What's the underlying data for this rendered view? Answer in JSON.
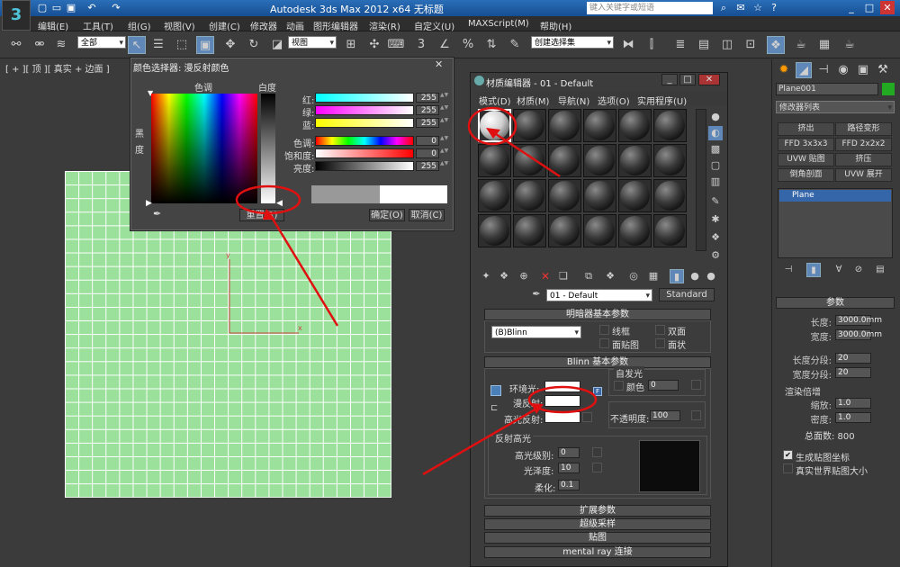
{
  "titlebar": {
    "app_title": "Autodesk 3ds Max  2012 x64     无标题",
    "search_placeholder": "键入关键字或短语",
    "logo": "3ds-max-logo"
  },
  "menus": [
    "编辑(E)",
    "工具(T)",
    "组(G)",
    "视图(V)",
    "创建(C)",
    "修改器",
    "动画",
    "图形编辑器",
    "渲染(R)",
    "自定义(U)",
    "MAXScript(M)",
    "帮助(H)"
  ],
  "toolbar": {
    "filter": "全部",
    "ref_coord": "视图",
    "named_sel": "创建选择集"
  },
  "viewport": {
    "label": "[ + ][ 顶 ][ 真实 + 边面 ]",
    "axis_x": "x",
    "axis_y": "y"
  },
  "color_picker": {
    "title": "颜色选择器: 漫反射颜色",
    "hue_label": "色调",
    "whiteness_label": "白度",
    "black_label": "黑",
    "degree_label": "度",
    "rows": [
      {
        "label": "红:",
        "value": "255"
      },
      {
        "label": "绿:",
        "value": "255"
      },
      {
        "label": "蓝:",
        "value": "255"
      },
      {
        "label": "色调:",
        "value": "0"
      },
      {
        "label": "饱和度:",
        "value": "0"
      },
      {
        "label": "亮度:",
        "value": "255"
      }
    ],
    "reset": "重置(R)",
    "ok": "确定(O)",
    "cancel": "取消(C)"
  },
  "material_editor": {
    "title": "材质编辑器 - 01 - Default",
    "menu": [
      "模式(D)",
      "材质(M)",
      "导航(N)",
      "选项(O)",
      "实用程序(U)"
    ],
    "material_name": "01 - Default",
    "material_type": "Standard",
    "shader_rollout": "明暗器基本参数",
    "shader": "(B)Blinn",
    "opts": [
      "线框",
      "双面",
      "面贴图",
      "面状"
    ],
    "blinn_rollout": "Blinn 基本参数",
    "self_illum": "自发光",
    "self_color": "颜色",
    "self_value": "0",
    "ambient": "环境光:",
    "diffuse": "漫反射:",
    "specular": "高光反射:",
    "opacity_label": "不透明度:",
    "opacity": "100",
    "spec_group": "反射高光",
    "spec_level_lbl": "高光级别:",
    "spec_level": "0",
    "gloss_lbl": "光泽度:",
    "gloss": "10",
    "soften_lbl": "柔化:",
    "soften": "0.1",
    "rollouts": [
      "扩展参数",
      "超级采样",
      "贴图",
      "mental ray 连接"
    ]
  },
  "command_panel": {
    "object_name": "Plane001",
    "modifier_list": "修改器列表",
    "buttons": [
      "挤出",
      "路径变形",
      "FFD 3x3x3",
      "FFD 2x2x2",
      "UVW 贴图",
      "挤压",
      "倒角剖面",
      "UVW 展开"
    ],
    "stack_item": "Plane",
    "params_title": "参数",
    "length_lbl": "长度:",
    "length": "3000.0mm",
    "width_lbl": "宽度:",
    "width": "3000.0mm",
    "lseg_lbl": "长度分段:",
    "lseg": "20",
    "wseg_lbl": "宽度分段:",
    "wseg": "20",
    "render_mult": "渲染倍增",
    "scale_lbl": "缩放:",
    "scale": "1.0",
    "density_lbl": "密度:",
    "density": "1.0",
    "faces": "总面数: 800",
    "gen_uv": "生成贴图坐标",
    "real_world": "真实世界贴图大小"
  },
  "colors": {
    "accent": "#5f88b8",
    "grid": "#9be09b",
    "annotation": "#e01010"
  }
}
